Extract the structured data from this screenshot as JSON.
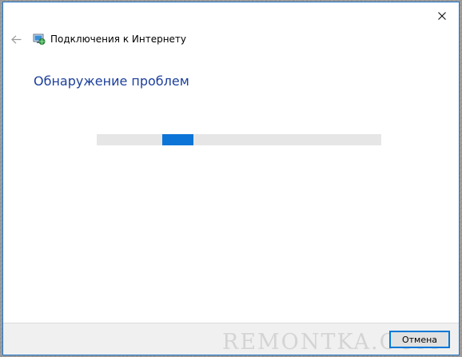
{
  "window": {
    "title": "Подключения к Интернету",
    "accent_color": "#1e75c8"
  },
  "header": {
    "back_icon": "back-arrow-icon",
    "close_icon": "close-icon",
    "app_icon": "network-connection-icon"
  },
  "main": {
    "heading": "Обнаружение проблем",
    "heading_color": "#1c3f9b",
    "progress": {
      "mode": "indeterminate",
      "position_fraction": 0.23,
      "chunk_fraction": 0.11,
      "track_color": "#e6e6e6",
      "chunk_color": "#0c74d6"
    }
  },
  "footer": {
    "watermark": "REMONTKA.COM",
    "cancel_label": "Отмена"
  }
}
